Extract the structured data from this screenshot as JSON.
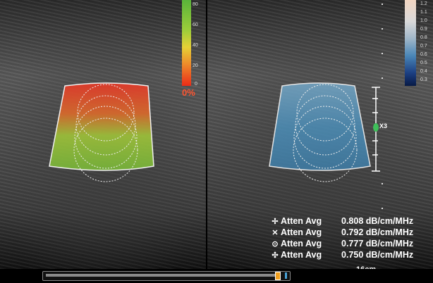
{
  "colorbar_left": {
    "ticks": [
      "80",
      "60",
      "40",
      "20",
      "0"
    ],
    "min_label": "0%"
  },
  "colorbar_right": {
    "ticks": [
      "1.2",
      "1.1",
      "1.0",
      "0.9",
      "0.8",
      "0.7",
      "0.6",
      "0.5",
      "0.4",
      "0.3"
    ]
  },
  "zoom_label": "X3",
  "measurements": [
    {
      "symbol": "✢",
      "label": "Atten Avg",
      "value": "0.808 dB/cm/MHz"
    },
    {
      "symbol": "✕",
      "label": "Atten Avg",
      "value": "0.792 dB/cm/MHz"
    },
    {
      "symbol": "⊙",
      "label": "Atten Avg",
      "value": "0.777 dB/cm/MHz"
    },
    {
      "symbol": "✣",
      "label": "Atten Avg",
      "value": "0.750 dB/cm/MHz"
    }
  ],
  "depth": "16cm",
  "slider_position": 0.94,
  "colors": {
    "roi_left": [
      "#e54a2a",
      "#c9b83a",
      "#7fbf3c"
    ],
    "roi_right": "#4b8fb4"
  }
}
